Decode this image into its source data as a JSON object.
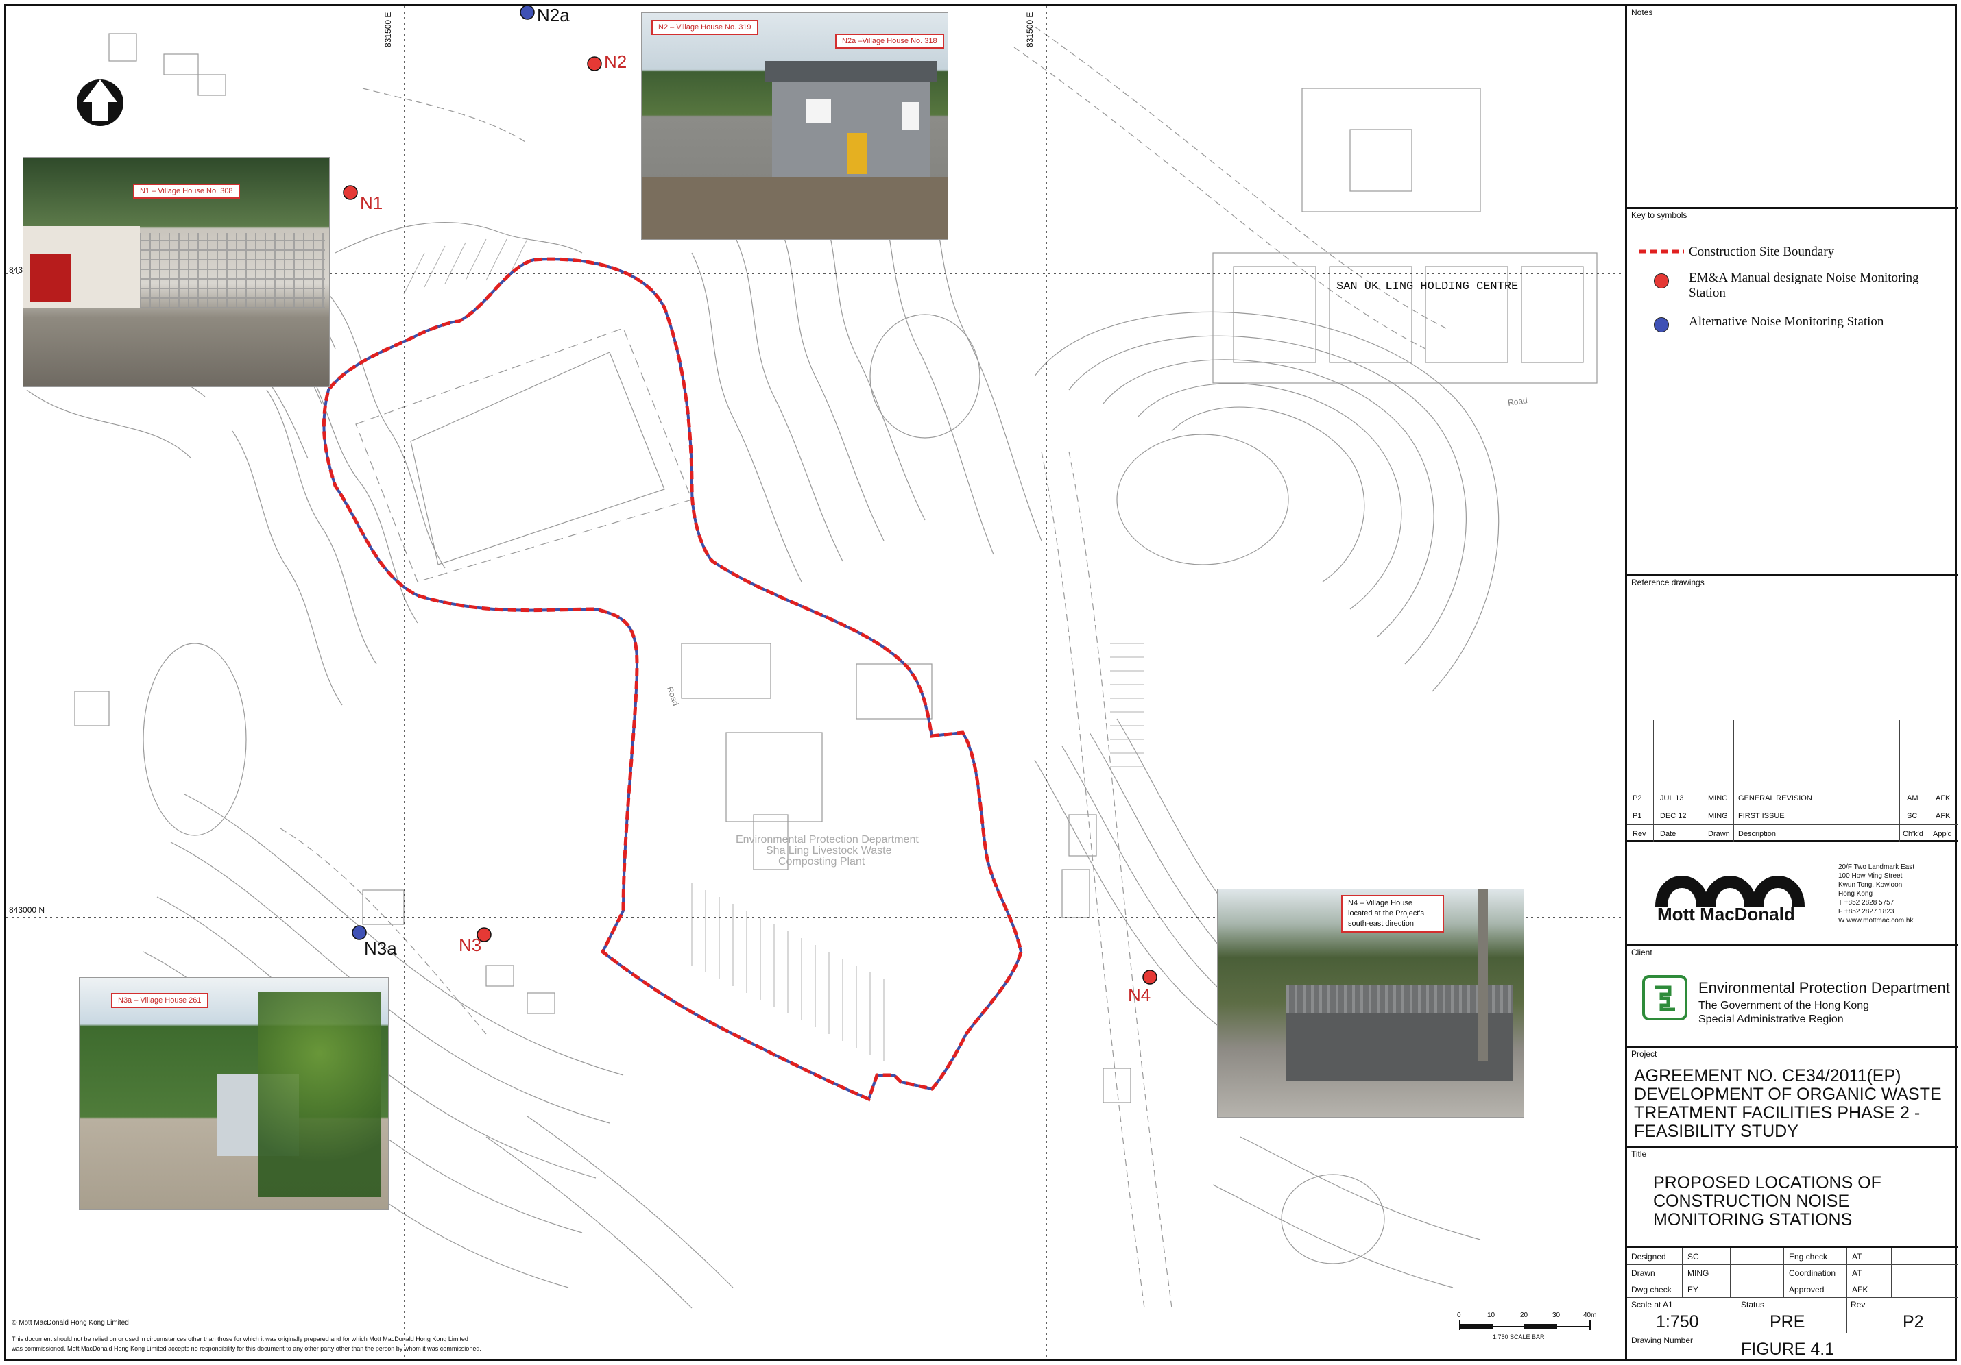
{
  "map": {
    "area_label": "SAN UK LING HOLDING CENTRE",
    "plant_label_1": "Environmental Protection Department",
    "plant_label_2": "Sha Ling Livestock Waste",
    "plant_label_3": "Composting Plant",
    "grid_e1": "831500 E",
    "grid_e2": "831500 E",
    "grid_n": "843000 N",
    "grid_n_top": "843",
    "road_label": "Road",
    "stations": [
      {
        "id": "N1",
        "type": "em&a"
      },
      {
        "id": "N2",
        "type": "em&a"
      },
      {
        "id": "N2a",
        "type": "alternative"
      },
      {
        "id": "N3",
        "type": "em&a"
      },
      {
        "id": "N3a",
        "type": "alternative"
      },
      {
        "id": "N4",
        "type": "em&a"
      }
    ],
    "photos": {
      "n1": "N1 – Village House No. 308",
      "n2_a": "N2 – Village House No. 319",
      "n2_b": "N2a –Village House No. 318",
      "n3a": "N3a – Village House 261",
      "n4": "N4 – Village House located at the Project's south-east direction"
    },
    "scale_bar": {
      "ticks": [
        "0",
        "10",
        "20",
        "30",
        "40m"
      ],
      "caption": "1:750 SCALE BAR"
    },
    "copyright": "© Mott MacDonald Hong Kong Limited",
    "disclaimer_1": "This document should not be relied on or used in circumstances other than those for which it was originally prepared and for which Mott MacDonald Hong Kong Limited",
    "disclaimer_2": "was commissioned. Mott MacDonald Hong Kong Limited accepts no responsibility for this document to any other party other than the person by whom it was commissioned.",
    "colors": {
      "boundary": "#e02020",
      "em_station": "#e53935",
      "alt_station": "#3f51b5"
    }
  },
  "panel": {
    "notes_label": "Notes",
    "key_label": "Key to symbols",
    "legend": [
      {
        "symbol": "red-dashed-line",
        "text": "Construction Site Boundary"
      },
      {
        "symbol": "red-dot",
        "text": "EM&A Manual designate Noise Monitoring Station"
      },
      {
        "symbol": "blue-dot",
        "text": "Alternative Noise Monitoring Station"
      }
    ],
    "reference_label": "Reference drawings",
    "revisions": [
      {
        "rev": "P2",
        "date": "JUL 13",
        "drawn": "MING",
        "desc": "GENERAL REVISION",
        "chkd": "AM",
        "appd": "AFK"
      },
      {
        "rev": "P1",
        "date": "DEC 12",
        "drawn": "MING",
        "desc": "FIRST ISSUE",
        "chkd": "SC",
        "appd": "AFK"
      }
    ],
    "rev_headers": {
      "rev": "Rev",
      "date": "Date",
      "drawn": "Drawn",
      "desc": "Description",
      "chkd": "Ch'k'd",
      "appd": "App'd"
    },
    "company": {
      "name": "Mott MacDonald",
      "address": [
        "20/F Two Landmark East",
        "100 How Ming Street",
        "Kwun Tong, Kowloon",
        "Hong Kong",
        "T +852 2828 5757",
        "F +852 2827 1823",
        "W www.mottmac.com.hk"
      ]
    },
    "client_label": "Client",
    "client": {
      "name": "Environmental Protection Department",
      "line2": "The Government of the Hong Kong",
      "line3": "Special Administrative Region"
    },
    "project_label": "Project",
    "project": "AGREEMENT NO. CE34/2011(EP) DEVELOPMENT OF ORGANIC WASTE TREATMENT FACILITIES PHASE 2 - FEASIBILITY STUDY",
    "title_label": "Title",
    "title": "PROPOSED LOCATIONS OF CONSTRUCTION NOISE MONITORING STATIONS",
    "titleblock": {
      "designed_label": "Designed",
      "designed": "SC",
      "drawn_label": "Drawn",
      "drawn": "MING",
      "dwgcheck_label": "Dwg check",
      "dwgcheck": "EY",
      "engcheck_label": "Eng check",
      "engcheck": "AT",
      "coord_label": "Coordination",
      "coord": "AT",
      "approved_label": "Approved",
      "approved": "AFK",
      "scale_label": "Scale at A1",
      "scale": "1:750",
      "status_label": "Status",
      "status": "PRE",
      "rev_label": "Rev",
      "rev": "P2",
      "dwgno_label": "Drawing Number",
      "dwgno": "FIGURE 4.1"
    }
  }
}
